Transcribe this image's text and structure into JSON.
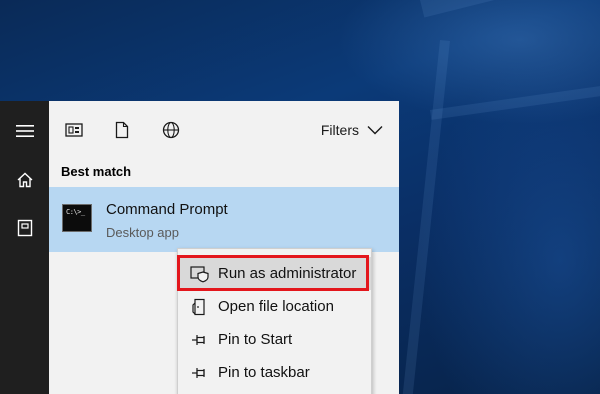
{
  "colors": {
    "accent_selection": "#b7d7f2",
    "highlight_border": "#e3161c",
    "rail_background": "#1f1f1f",
    "panel_background": "#f2f2f2"
  },
  "rail": {
    "icons": [
      "hamburger-menu-icon",
      "home-icon",
      "notebook-icon"
    ]
  },
  "toolbar": {
    "icons": [
      "apps-icon",
      "documents-icon",
      "web-icon"
    ],
    "filters_label": "Filters"
  },
  "search": {
    "section_heading": "Best match",
    "result": {
      "title": "Command Prompt",
      "subtitle": "Desktop app",
      "icon": "command-prompt-icon",
      "icon_text": "C:\\>_"
    }
  },
  "context_menu": {
    "items": [
      {
        "label": "Run as administrator",
        "icon": "shield-icon"
      },
      {
        "label": "Open file location",
        "icon": "file-location-icon"
      },
      {
        "label": "Pin to Start",
        "icon": "pin-icon"
      },
      {
        "label": "Pin to taskbar",
        "icon": "pin-icon"
      }
    ]
  }
}
